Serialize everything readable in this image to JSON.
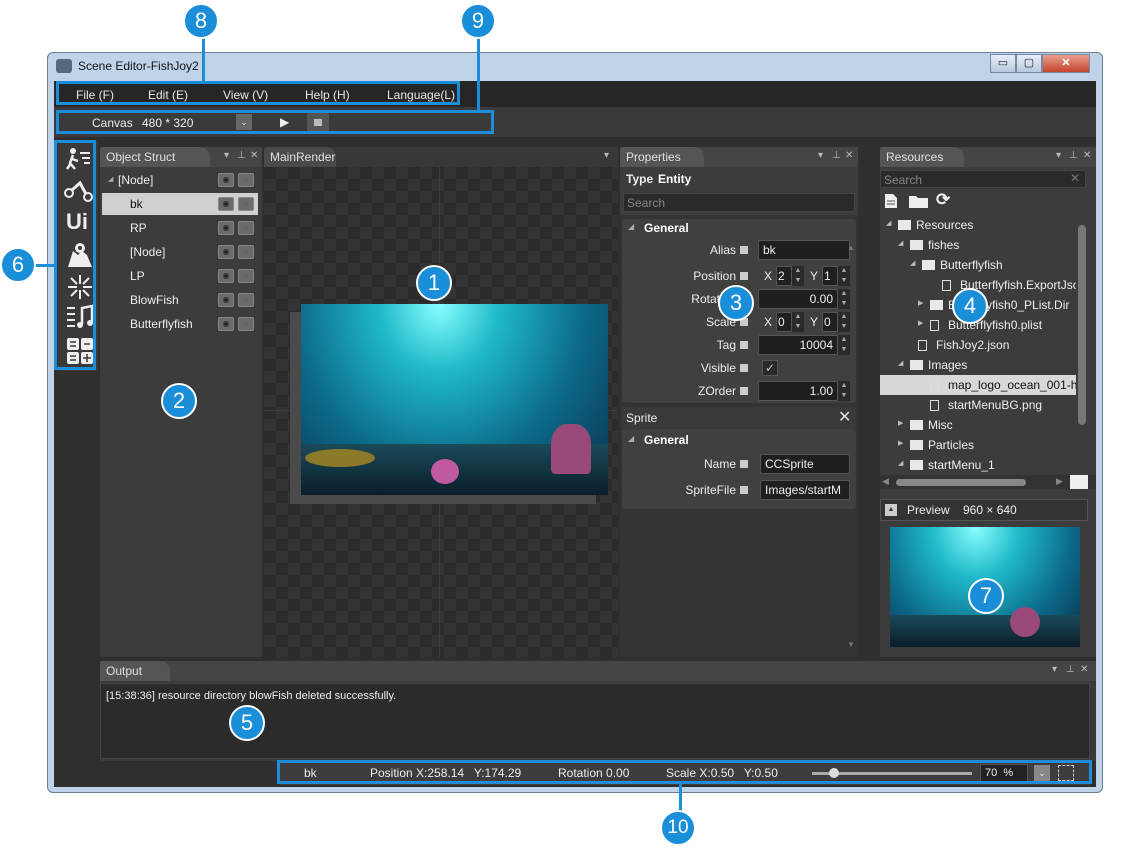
{
  "window": {
    "title": "Scene Editor-FishJoy2",
    "min": "▭",
    "max": "▢",
    "close": "✕"
  },
  "menu": {
    "items": [
      "File (F)",
      "Edit (E)",
      "View (V)",
      "Help (H)",
      "Language(L)"
    ]
  },
  "toolbar": {
    "canvas_label": "Canvas",
    "canvas_size": "480 * 320"
  },
  "object_struct": {
    "tab": "Object Struct",
    "items": [
      {
        "label": "[Node]",
        "indent": 0
      },
      {
        "label": "bk",
        "indent": 1
      },
      {
        "label": "RP",
        "indent": 1
      },
      {
        "label": "[Node]",
        "indent": 1
      },
      {
        "label": "LP",
        "indent": 1
      },
      {
        "label": "BlowFish",
        "indent": 1
      },
      {
        "label": "Butterflyfish",
        "indent": 1
      }
    ]
  },
  "render": {
    "tab": "MainRender"
  },
  "properties": {
    "tab": "Properties",
    "type_label": "Type",
    "type_value": "Entity",
    "search_placeholder": "Search",
    "general_label": "General",
    "alias_label": "Alias",
    "alias_value": "bk",
    "position_label": "Position",
    "pos_x_label": "X",
    "pos_x": "2",
    "pos_y_label": "Y",
    "pos_y": "1",
    "rotation_label": "Rotation",
    "rotation": "0.00",
    "scale_label": "Scale",
    "scale_x_label": "X",
    "scale_x": "0",
    "scale_y_label": "Y",
    "scale_y": "0",
    "tag_label": "Tag",
    "tag": "10004",
    "visible_label": "Visible",
    "visible_check": "✓",
    "zorder_label": "ZOrder",
    "zorder": "1.00",
    "sprite_label": "Sprite",
    "sprite_general": "General",
    "name_label": "Name",
    "name": "CCSprite",
    "spritefile_label": "SpriteFile",
    "spritefile": "Images/startM"
  },
  "resources": {
    "tab": "Resources",
    "search_placeholder": "Search",
    "items": [
      {
        "label": "Resources",
        "type": "folder",
        "arrow": "◢"
      },
      {
        "label": "fishes",
        "type": "folder",
        "arrow": "◢"
      },
      {
        "label": "Butterflyfish",
        "type": "folder",
        "arrow": "◢"
      },
      {
        "label": "Butterflyfish.ExportJson",
        "type": "file",
        "arrow": ""
      },
      {
        "label": "Butterflyfish0_PList.Dir",
        "type": "folder",
        "arrow": "▶"
      },
      {
        "label": "Butterflyfish0.plist",
        "type": "file",
        "arrow": "▶"
      },
      {
        "label": "FishJoy2.json",
        "type": "file",
        "arrow": ""
      },
      {
        "label": "Images",
        "type": "folder",
        "arrow": "◢"
      },
      {
        "label": "map_logo_ocean_001-h",
        "type": "file",
        "arrow": ""
      },
      {
        "label": "startMenuBG.png",
        "type": "file",
        "arrow": ""
      },
      {
        "label": "Misc",
        "type": "folder",
        "arrow": "▶"
      },
      {
        "label": "Particles",
        "type": "folder",
        "arrow": "▶"
      },
      {
        "label": "startMenu_1",
        "type": "folder",
        "arrow": "◢"
      }
    ],
    "preview_label": "Preview",
    "preview_size": "960 × 640"
  },
  "output": {
    "tab": "Output",
    "log": "[15:38:36]  resource directory blowFish deleted successfully."
  },
  "status": {
    "selected": "bk",
    "position": "Position X:258.14   Y:174.29",
    "rotation": "Rotation 0.00",
    "scale": "Scale X:0.50   Y:0.50",
    "zoom": "70",
    "zoom_unit": "%"
  },
  "callouts": [
    "1",
    "2",
    "3",
    "4",
    "5",
    "6",
    "7",
    "8",
    "9",
    "10"
  ],
  "colors": {
    "callout": "#1a8ed8",
    "highlight_box": "#1a8ed8",
    "panel": "#3c3c3c"
  }
}
